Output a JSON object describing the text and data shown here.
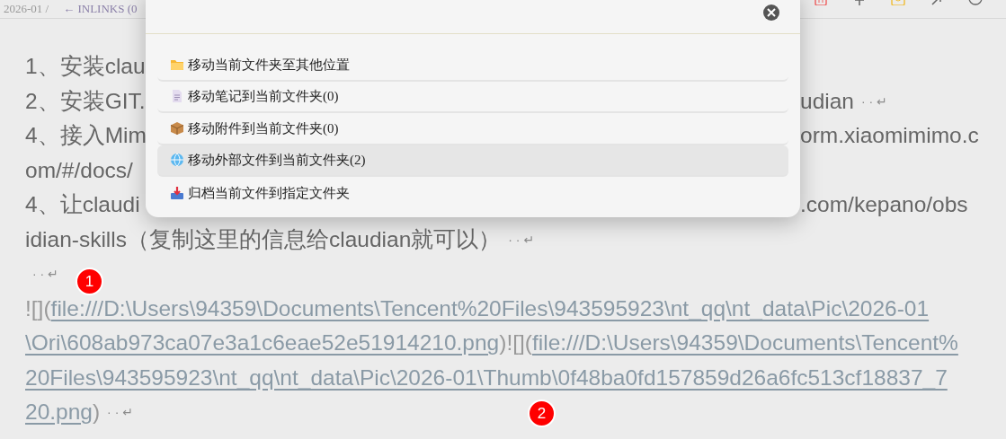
{
  "top_bar": {
    "breadcrumb": "2026-01 /",
    "inlinks": "← INLINKS (0"
  },
  "editor": {
    "lines": [
      {
        "left": "1、安装clau"
      },
      {
        "left": "2、安装GIT.",
        "right": "udian",
        "eol": "· · ↵"
      },
      {
        "left": "4、接入Mim",
        "right": "orm.xiaomimimo.c"
      },
      {
        "left": "om/#/docs/"
      },
      {
        "left": "4、让claudi",
        "right": ".com/kepano/obs"
      },
      {
        "left": "idian-skills（复制这里的信息给claudian就可以）",
        "eol": "· · ↵"
      },
      {
        "eol": "· · ↵"
      }
    ],
    "link_lines": [
      [
        {
          "kind": "syntax",
          "text": "![]("
        },
        {
          "kind": "link",
          "text": "file:///D:\\Users\\94359\\Documents\\Tencent%20Files\\943595923\\nt_qq\\nt_data\\Pic\\2026-01"
        }
      ],
      [
        {
          "kind": "link",
          "text": "\\Ori\\608ab973ca07e3a1c6eae52e51914210.png"
        },
        {
          "kind": "syntax",
          "text": ")![]("
        },
        {
          "kind": "link",
          "text": "file:///D:\\Users\\94359\\Documents\\Tencent%"
        }
      ],
      [
        {
          "kind": "link",
          "text": "20Files\\943595923\\nt_qq\\nt_data\\Pic\\2026-01\\Thumb\\0f48ba0fd157859d26a6fc513cf18837_7"
        }
      ],
      [
        {
          "kind": "link",
          "text": "20.png"
        },
        {
          "kind": "syntax",
          "text": ")"
        },
        {
          "kind": "eol",
          "text": "· · ↵"
        }
      ]
    ]
  },
  "markers": [
    "1",
    "2"
  ],
  "dialog": {
    "items": [
      {
        "kind": "folder",
        "label": "移动当前文件夹至其他位置",
        "selected": false
      },
      {
        "kind": "note",
        "label": "移动笔记到当前文件夹(0)",
        "selected": false
      },
      {
        "kind": "package",
        "label": "移动附件到当前文件夹(0)",
        "selected": false
      },
      {
        "kind": "globe",
        "label": "移动外部文件到当前文件夹(2)",
        "selected": true
      },
      {
        "kind": "archive",
        "label": "归档当前文件到指定文件夹",
        "selected": false
      }
    ]
  }
}
